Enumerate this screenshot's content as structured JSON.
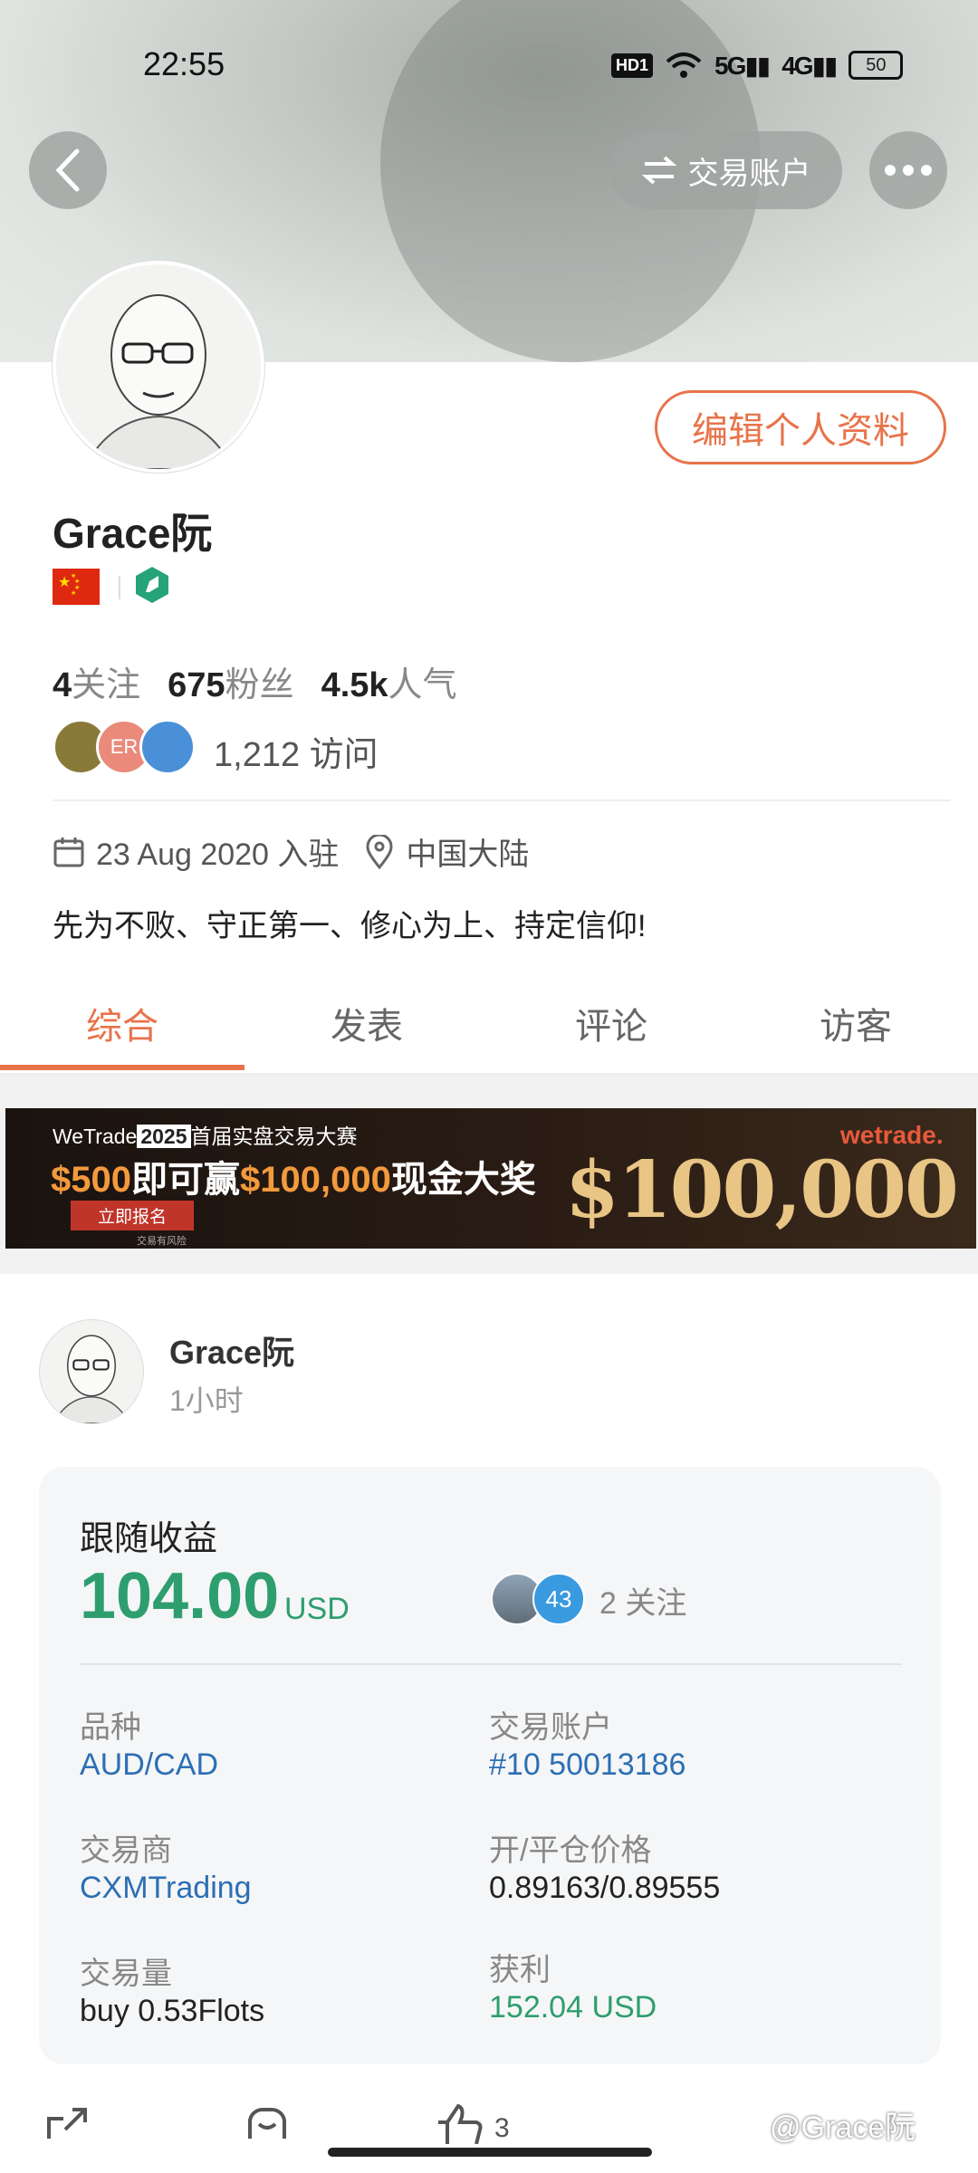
{
  "status_bar": {
    "time": "22:55",
    "hd": "HD1",
    "net1": "5G",
    "net2": "4G",
    "battery": "50"
  },
  "header": {
    "trade_account_label": "交易账户"
  },
  "profile": {
    "edit_label": "编辑个人资料",
    "name": "Grace阮",
    "stats": {
      "following": "4",
      "following_label": "关注",
      "fans": "675",
      "fans_label": "粉丝",
      "popularity": "4.5k",
      "popularity_label": "人气"
    },
    "visitor_badge": "ER",
    "visits": "1,212 访问",
    "joined": "23 Aug 2020 入驻",
    "location": "中国大陆",
    "bio": "先为不败、守正第一、修心为上、持定信仰!"
  },
  "tabs": [
    {
      "label": "综合"
    },
    {
      "label": "发表"
    },
    {
      "label": "评论"
    },
    {
      "label": "访客"
    }
  ],
  "banner": {
    "line1_a": "WeTrade",
    "line1_year": "2025",
    "line1_b": "首届实盘交易大赛",
    "amount1": "$500",
    "mid1": "即可赢",
    "amount2": "$100,000",
    "mid2": "现金大奖",
    "cta": "立即报名",
    "risk": "交易有风险",
    "big": "$100,000",
    "brand": "wetrade."
  },
  "post": {
    "author": "Grace阮",
    "time": "1小时",
    "card": {
      "title": "跟随收益",
      "value": "104.00",
      "unit": "USD",
      "follower_count_badge": "43",
      "follows": "2 关注",
      "fields": {
        "symbol_label": "品种",
        "symbol": "AUD/CAD",
        "account_label": "交易账户",
        "account": "#10 50013186",
        "broker_label": "交易商",
        "broker": "CXMTrading",
        "price_label": "开/平仓价格",
        "price": "0.89163/0.89555",
        "volume_label": "交易量",
        "volume": "buy 0.53Flots",
        "profit_label": "获利",
        "profit": "152.04 USD"
      }
    },
    "likes": "3"
  },
  "watermark": "@Grace阮",
  "colors": {
    "accent": "#e8734a",
    "green": "#2e9e6e",
    "link": "#2c6fb5"
  }
}
